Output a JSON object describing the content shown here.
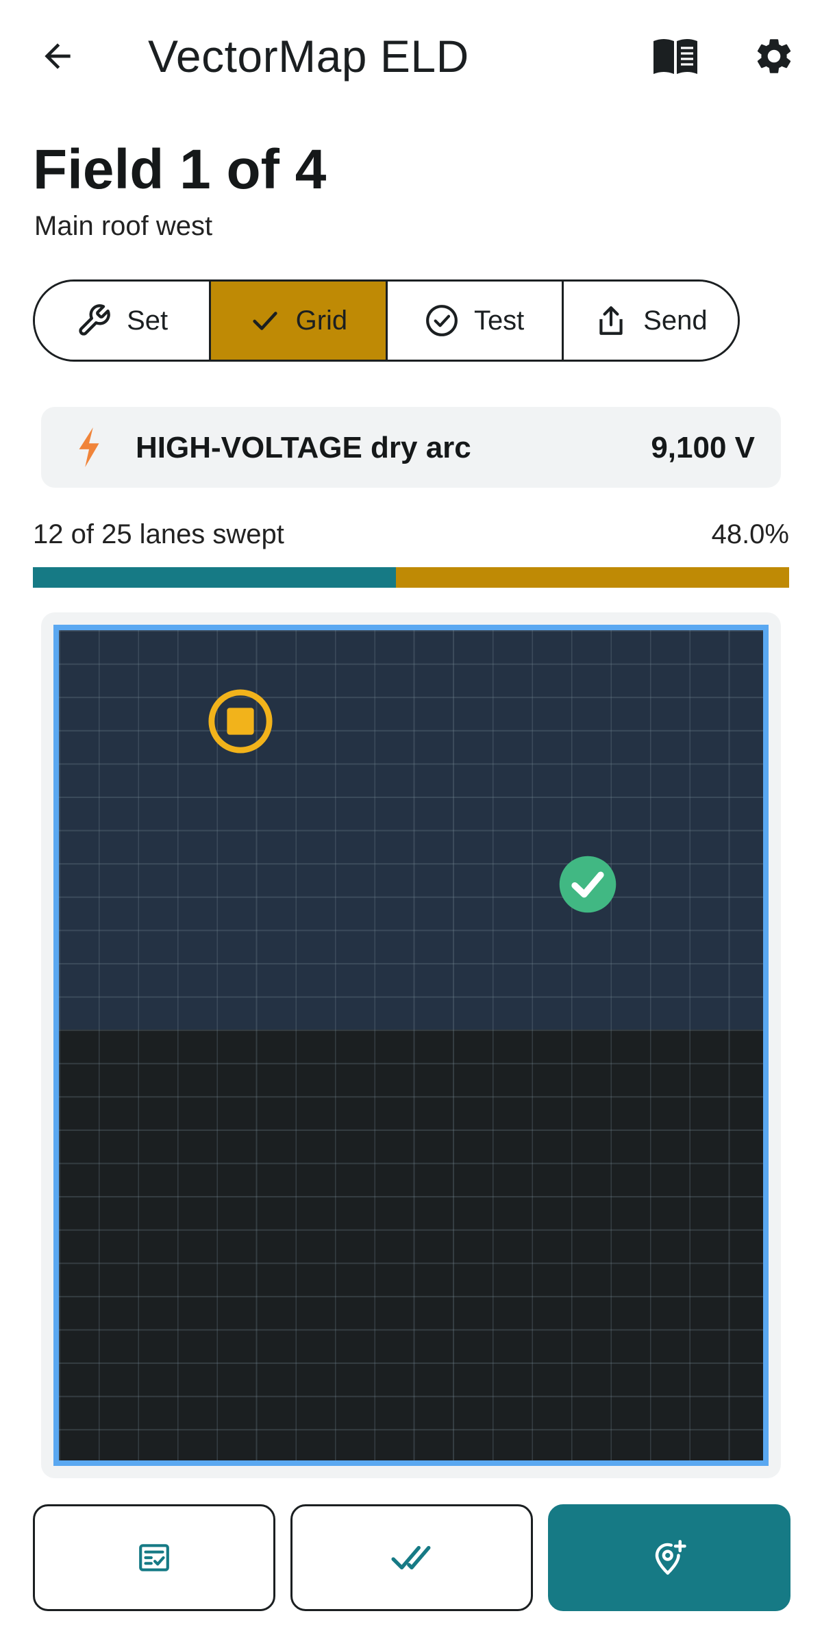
{
  "app_bar": {
    "title": "VectorMap ELD",
    "back_icon": "arrow-left-icon",
    "manual_icon": "book-icon",
    "settings_icon": "gear-icon"
  },
  "field": {
    "title": "Field 1 of 4",
    "subtitle": "Main roof west"
  },
  "steps": [
    {
      "label": "Set",
      "icon": "wrench-icon",
      "active": false
    },
    {
      "label": "Grid",
      "icon": "check-icon",
      "active": true
    },
    {
      "label": "Test",
      "icon": "check-circle-icon",
      "active": false
    },
    {
      "label": "Send",
      "icon": "share-icon",
      "active": false
    }
  ],
  "hazard": {
    "icon": "lightning-bolt-icon",
    "label": "HIGH-VOLTAGE dry arc",
    "value": "9,100 V"
  },
  "progress": {
    "label": "12 of 25 lanes swept",
    "percent_text": "48.0%",
    "fraction": 0.48
  },
  "map": {
    "markers": [
      {
        "type": "suspected-breach",
        "icon": "target-square-icon"
      },
      {
        "type": "cleared",
        "icon": "check-circle-icon"
      }
    ]
  },
  "actions": [
    {
      "name": "review-checklist",
      "icon": "checklist-icon"
    },
    {
      "name": "confirm",
      "icon": "double-check-icon"
    },
    {
      "name": "add-marker",
      "icon": "map-pin-plus-icon"
    }
  ],
  "colors": {
    "accent": "#bf8a05",
    "primary": "#167a85",
    "hazard_icon": "#f0843a",
    "map_border": "#5aa8f1",
    "swept_zone": "#243244",
    "unswept_zone": "#1b1f21",
    "marker_target": "#f2b31b",
    "marker_cleared": "#41b883"
  }
}
